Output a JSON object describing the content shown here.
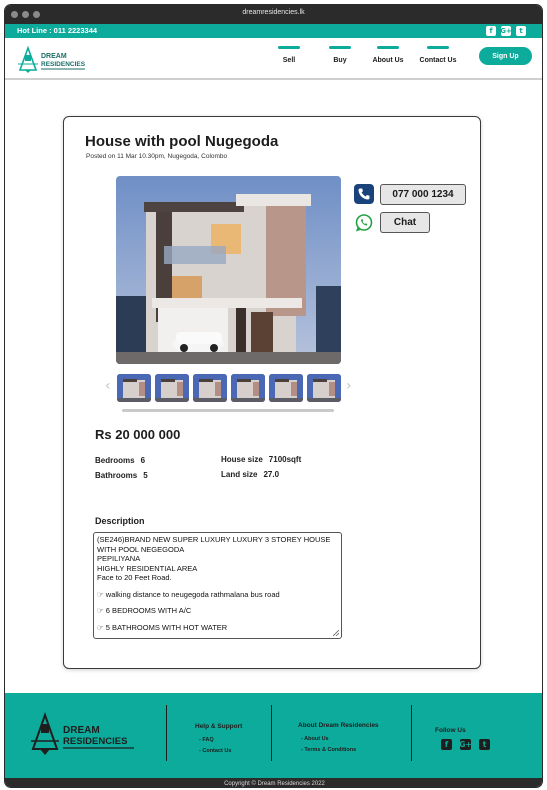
{
  "browser": {
    "url": "dreamresidencies.lk"
  },
  "topbar": {
    "hotline": "Hot Line : 011 2223344",
    "social_icons": [
      "facebook-icon",
      "google-plus-icon",
      "twitter-icon"
    ]
  },
  "brand": {
    "line1": "DREAM",
    "line2": "RESIDENCIES"
  },
  "nav": {
    "items": [
      "Sell",
      "Buy",
      "About Us",
      "Contact  Us"
    ],
    "signup": "Sign Up"
  },
  "listing": {
    "title": "House with pool Nugegoda",
    "posted": "Posted on 11 Mar 10.30pm, Nugegoda, Colombo",
    "phone": "077 000 1234",
    "chat": "Chat",
    "price": "Rs 20 000 000",
    "specs": {
      "bedrooms_label": "Bedrooms",
      "bedrooms": "6",
      "bathrooms_label": "Bathrooms",
      "bathrooms": "5",
      "house_size_label": "House size",
      "house_size": "7100sqft",
      "land_size_label": "Land size",
      "land_size": "27.0"
    },
    "description_heading": "Description",
    "description": [
      "(SE246)BRAND NEW SUPER LUXURY LUXURY 3 STOREY HOUSE WITH POOL NEGEGODA",
      "PEPILIYANA",
      "HIGHLY RESIDENTIAL AREA",
      "Face to 20 Feet Road.",
      "",
      "☞ walking distance to neugegoda rathmalana bus road",
      "",
      "☞ 6 BEDROOMS WITH A/C",
      "",
      "☞ 5 BATHROOMS WITH HOT WATER"
    ]
  },
  "footer": {
    "help_heading": "Help & Support",
    "help_links": [
      "- FAQ",
      "- Contact Us"
    ],
    "about_heading": "About Dream Residencies",
    "about_links": [
      "- About Us",
      "- Terms & Conditions"
    ],
    "follow_heading": "Follow Us",
    "copyright": "Copyright © Dream Residencies 2022"
  },
  "colors": {
    "accent": "#0dab9b",
    "dark": "#2b2b2b",
    "phone_icon": "#19437a",
    "whatsapp": "#25a244"
  }
}
